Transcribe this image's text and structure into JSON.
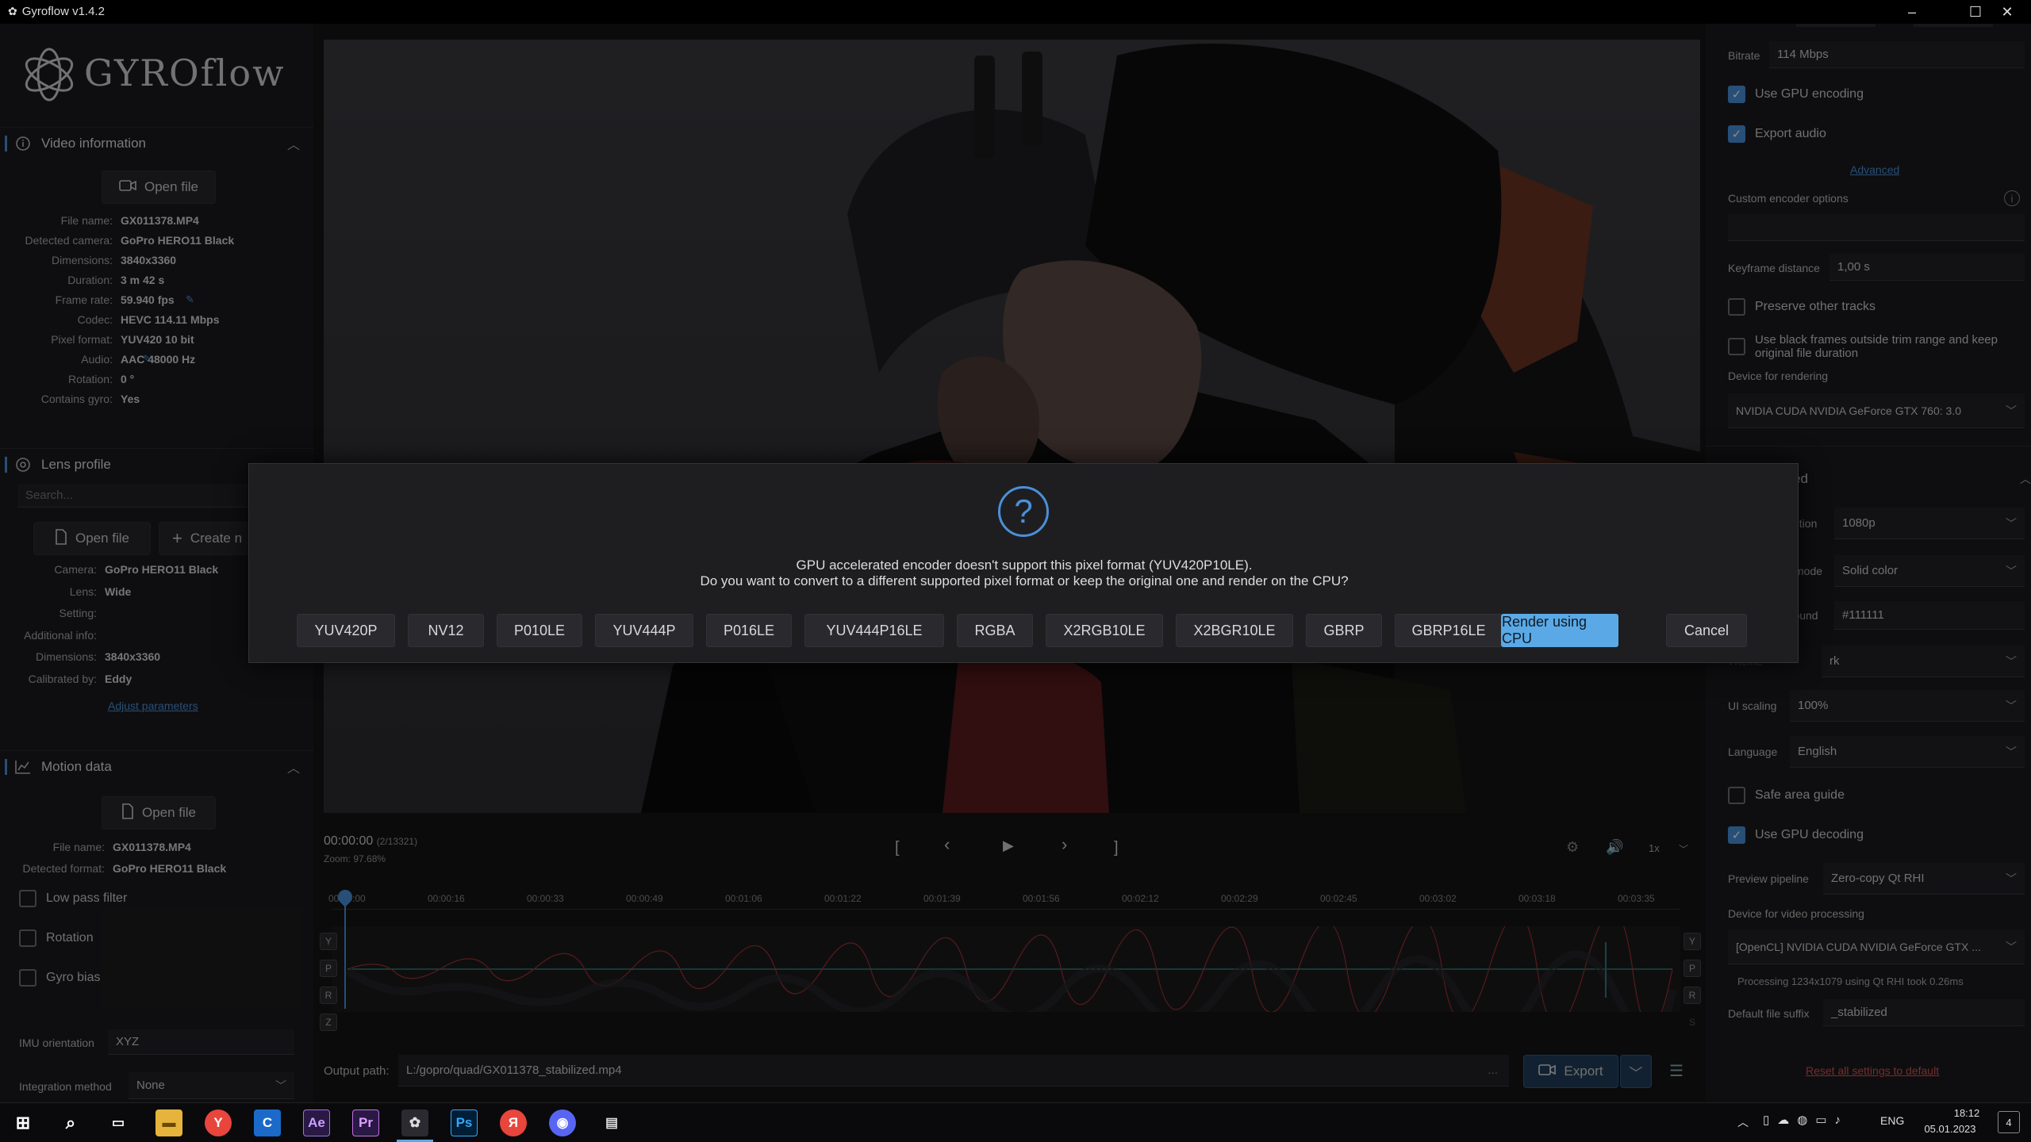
{
  "window": {
    "title": "Gyroflow v1.4.2",
    "minimize": "–",
    "maximize": "☐",
    "close": "✕"
  },
  "logo": {
    "text": "GYROflow"
  },
  "video_info": {
    "header": "Video information",
    "open_file": "Open file",
    "rows": [
      {
        "k": "File name:",
        "v": "GX011378.MP4"
      },
      {
        "k": "Detected camera:",
        "v": "GoPro HERO11 Black"
      },
      {
        "k": "Dimensions:",
        "v": "3840x3360"
      },
      {
        "k": "Duration:",
        "v": "3 m 42 s"
      },
      {
        "k": "Frame rate:",
        "v": "59.940 fps"
      },
      {
        "k": "Codec:",
        "v": "HEVC 114.11 Mbps"
      },
      {
        "k": "Pixel format:",
        "v": "YUV420 10 bit"
      },
      {
        "k": "Audio:",
        "v": "AAC 48000 Hz"
      },
      {
        "k": "Rotation:",
        "v": "0 °"
      },
      {
        "k": "Contains gyro:",
        "v": "Yes"
      }
    ]
  },
  "lens": {
    "header": "Lens profile",
    "search_placeholder": "Search...",
    "open_file": "Open file",
    "create": "Create n",
    "rows": [
      {
        "k": "Camera:",
        "v": "GoPro HERO11 Black"
      },
      {
        "k": "Lens:",
        "v": "Wide"
      },
      {
        "k": "Setting:",
        "v": ""
      },
      {
        "k": "Additional info:",
        "v": ""
      },
      {
        "k": "Dimensions:",
        "v": "3840x3360"
      },
      {
        "k": "Calibrated by:",
        "v": "Eddy"
      }
    ],
    "adjust": "Adjust parameters"
  },
  "motion": {
    "header": "Motion data",
    "open_file": "Open file",
    "rows": [
      {
        "k": "File name:",
        "v": "GX011378.MP4"
      },
      {
        "k": "Detected format:",
        "v": "GoPro HERO11 Black"
      }
    ],
    "low_pass": "Low pass filter",
    "rotation": "Rotation",
    "gyro_bias": "Gyro bias",
    "imu_label": "IMU orientation",
    "imu_value": "XYZ",
    "integration_label": "Integration method",
    "integration_value": "None"
  },
  "player": {
    "time": "00:00:00",
    "frame": "(2/13321)",
    "zoom": "Zoom: 97.68%",
    "speed": "1x",
    "ticks": [
      "00:00:00",
      "00:00:16",
      "00:00:33",
      "00:00:49",
      "00:01:06",
      "00:01:22",
      "00:01:39",
      "00:01:56",
      "00:02:12",
      "00:02:29",
      "00:02:45",
      "00:03:02",
      "00:03:18",
      "00:03:35"
    ],
    "axes_left": [
      "Y",
      "P",
      "R",
      "Z"
    ],
    "axes_right": [
      "Y",
      "P",
      "R",
      "S"
    ]
  },
  "output": {
    "label": "Output path:",
    "path": "L:/gopro/quad/GX011378_stabilized.mp4",
    "dots": "...",
    "export": "Export"
  },
  "right": {
    "bitrate_label": "Bitrate",
    "bitrate_value": "114 Mbps",
    "gpu_encoding": "Use GPU encoding",
    "export_audio": "Export audio",
    "advanced": "Advanced",
    "custom_encoder": "Custom encoder options",
    "keyframe_label": "Keyframe distance",
    "keyframe_value": "1,00 s",
    "preserve_tracks": "Preserve other tracks",
    "black_frames": "Use black frames outside trim range and keep original file duration",
    "device_render_label": "Device for rendering",
    "device_render_value": "NVIDIA CUDA NVIDIA GeForce GTX 760: 3.0",
    "adv_header": "ed",
    "res_label": "ution",
    "res_value": "1080p",
    "mode_label": "mode",
    "mode_value": "Solid color",
    "bg_label": "ground",
    "bg_value": "#111111",
    "theme_label": "Theme",
    "theme_value": "rk",
    "ui_scaling_label": "UI scaling",
    "ui_scaling_value": "100%",
    "language_label": "Language",
    "language_value": "English",
    "safe_area": "Safe area guide",
    "gpu_decoding": "Use GPU decoding",
    "pipeline_label": "Preview pipeline",
    "pipeline_value": "Zero-copy Qt RHI",
    "device_video_label": "Device for video processing",
    "device_video_value": "[OpenCL] NVIDIA CUDA NVIDIA GeForce GTX ...",
    "processing": "Processing 1234x1079 using Qt RHI took 0.26ms",
    "suffix_label": "Default file suffix",
    "suffix_value": "_stabilized",
    "reset": "Reset all settings to default"
  },
  "dialog": {
    "icon": "?",
    "line1": "GPU accelerated encoder doesn't support this pixel format (YUV420P10LE).",
    "line2": "Do you want to convert to a different supported pixel format or keep the original one and render on the CPU?",
    "formats": [
      "YUV420P",
      "NV12",
      "P010LE",
      "YUV444P",
      "P016LE",
      "YUV444P16LE",
      "RGBA",
      "X2RGB10LE",
      "X2BGR10LE",
      "GBRP",
      "GBRP16LE"
    ],
    "render_cpu": "Render using CPU",
    "cancel": "Cancel"
  },
  "taskbar": {
    "lang": "ENG",
    "time": "18:12",
    "date": "05.01.2023",
    "notif": "4",
    "apps": [
      "Ae",
      "Pr",
      "Ps"
    ]
  },
  "colors": {
    "accent": "#4a90d9",
    "danger": "#d9534f",
    "panel": "#1b1b1e"
  }
}
